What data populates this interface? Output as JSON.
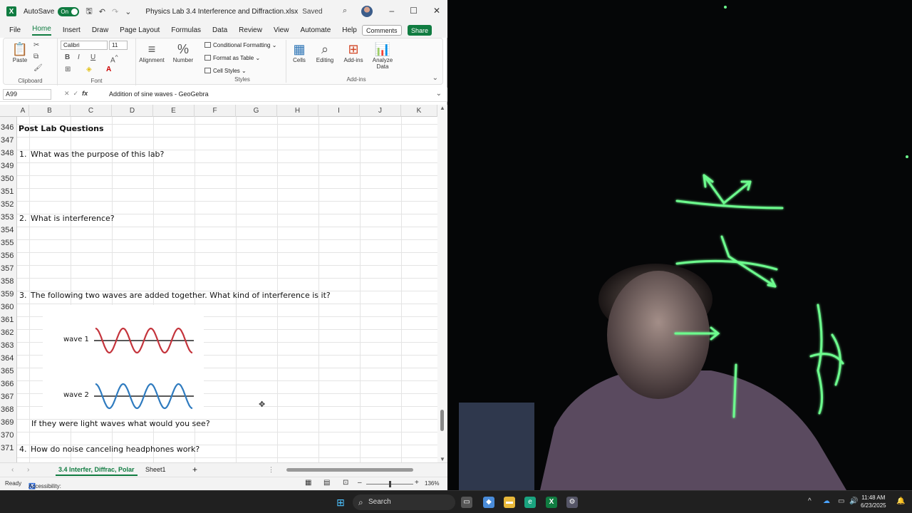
{
  "titlebar": {
    "autosave_label": "AutoSave",
    "autosave_state": "On",
    "document_title": "Physics Lab 3.4 Interference and Diffraction.xlsx",
    "save_status": "Saved"
  },
  "menu": {
    "items": [
      "File",
      "Home",
      "Insert",
      "Draw",
      "Page Layout",
      "Formulas",
      "Data",
      "Review",
      "View",
      "Automate",
      "Help"
    ],
    "active": "Home",
    "comments_label": "Comments",
    "share_label": "Share"
  },
  "ribbon": {
    "clipboard": {
      "paste_label": "Paste",
      "group_label": "Clipboard"
    },
    "font": {
      "font_name": "Calibri",
      "font_size": "11",
      "group_label": "Font",
      "bold": "B",
      "italic": "I",
      "underline": "U"
    },
    "alignment_label": "Alignment",
    "number_label": "Number",
    "styles": {
      "conditional": "Conditional Formatting",
      "table": "Format as Table",
      "cell_styles": "Cell Styles",
      "group_label": "Styles"
    },
    "cells_label": "Cells",
    "editing_label": "Editing",
    "addins_label": "Add-ins",
    "analyze_label_1": "Analyze",
    "analyze_label_2": "Data",
    "addins_group_label": "Add-ins"
  },
  "formula_bar": {
    "name_box": "A99",
    "fx_label": "fx",
    "content": "Addition of sine waves - GeoGebra"
  },
  "columns": [
    "A",
    "B",
    "C",
    "D",
    "E",
    "F",
    "G",
    "H",
    "I",
    "J",
    "K"
  ],
  "rows": [
    "346",
    "347",
    "348",
    "349",
    "350",
    "351",
    "352",
    "353",
    "354",
    "355",
    "356",
    "357",
    "358",
    "359",
    "360",
    "361",
    "362",
    "363",
    "364",
    "365",
    "366",
    "367",
    "368",
    "369",
    "370",
    "371"
  ],
  "cells": {
    "heading": "Post Lab Questions",
    "q1_num": "1.",
    "q1": "What was the purpose of this lab?",
    "q2_num": "2.",
    "q2": "What is interference?",
    "q3_num": "3.",
    "q3": "The following two waves are added together.  What kind of interference is it?",
    "wave1": "wave 1",
    "wave2": "wave 2",
    "q3b": "If they were light waves what would you see?",
    "q4_num": "4.",
    "q4": "How do noise canceling headphones work?"
  },
  "wave_colors": {
    "wave1": "#c4343c",
    "wave2": "#2f7bbf"
  },
  "sheet_tabs": {
    "active": "3.4 Interfer, Diffrac, Polar",
    "other": "Sheet1",
    "add": "+"
  },
  "status": {
    "ready": "Ready",
    "accessibility": "Accessibility: Investigate",
    "zoom": "136%"
  },
  "taskbar": {
    "search_placeholder": "Search",
    "time": "11:48 AM",
    "date": "6/23/2025"
  }
}
